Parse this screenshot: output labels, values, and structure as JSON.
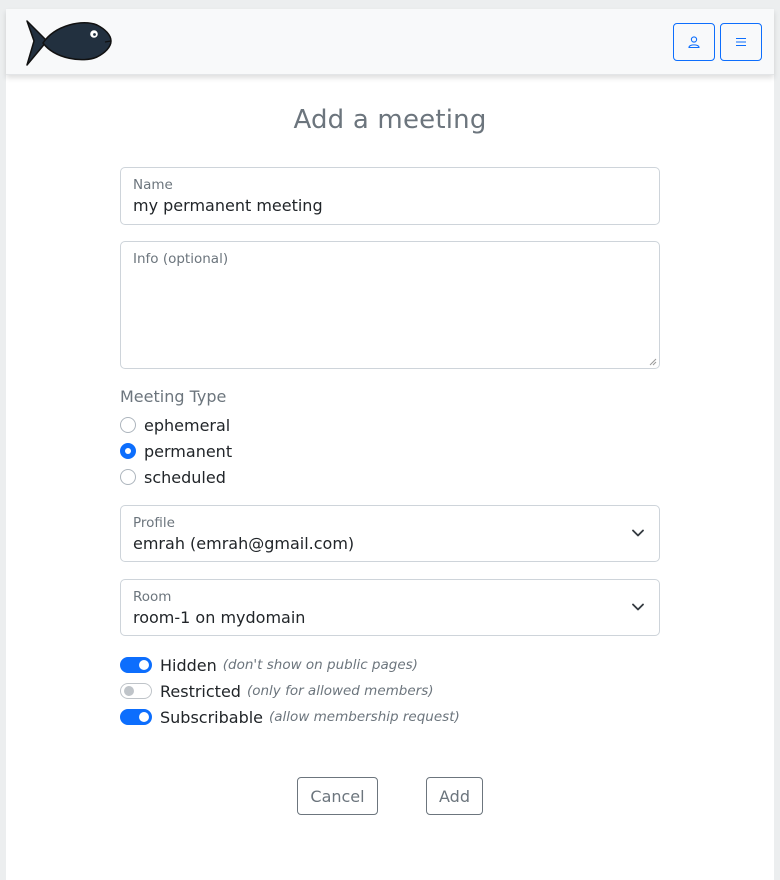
{
  "colors": {
    "accent": "#0d6efd",
    "muted": "#6c757d",
    "logo_fill": "#22303f"
  },
  "navbar": {
    "logo_icon": "fish-logo-icon",
    "user_icon": "user-icon",
    "menu_icon": "hamburger-menu-icon"
  },
  "page_title": "Add a meeting",
  "form": {
    "name": {
      "label": "Name",
      "value": "my permanent meeting"
    },
    "info": {
      "label": "Info (optional)",
      "value": ""
    },
    "meeting_type": {
      "label": "Meeting Type",
      "options": [
        {
          "label": "ephemeral",
          "checked": false
        },
        {
          "label": "permanent",
          "checked": true
        },
        {
          "label": "scheduled",
          "checked": false
        }
      ]
    },
    "profile": {
      "label": "Profile",
      "value": "emrah (emrah@gmail.com)"
    },
    "room": {
      "label": "Room",
      "value": "room-1 on mydomain"
    },
    "switches": [
      {
        "label": "Hidden",
        "hint": "(don't show on public pages)",
        "on": true
      },
      {
        "label": "Restricted",
        "hint": "(only for allowed members)",
        "on": false
      },
      {
        "label": "Subscribable",
        "hint": "(allow membership request)",
        "on": true
      }
    ]
  },
  "actions": {
    "cancel_label": "Cancel",
    "add_label": "Add"
  }
}
